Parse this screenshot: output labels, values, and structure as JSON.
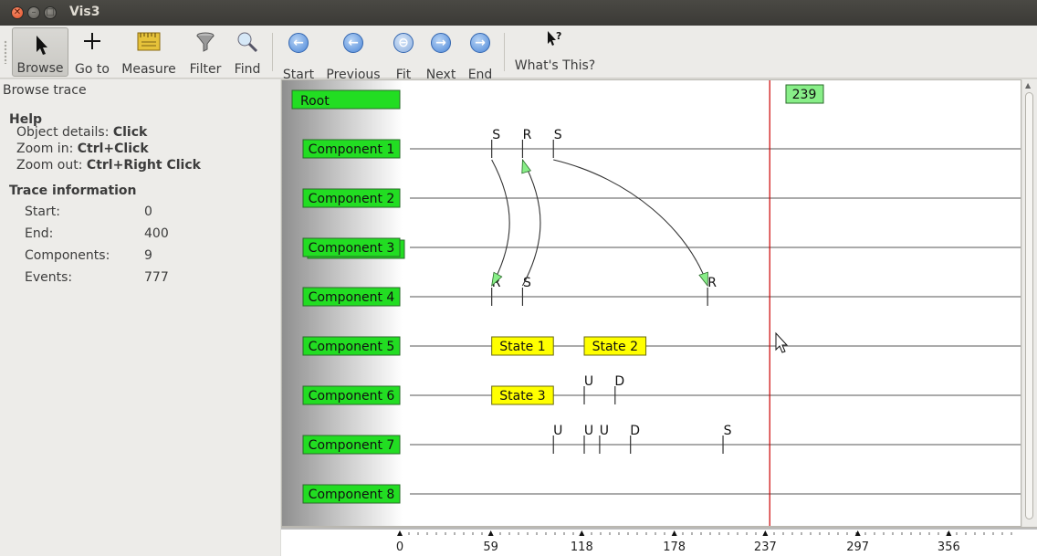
{
  "window": {
    "title": "Vis3",
    "close_glyph": "✕",
    "min_glyph": "–",
    "max_glyph": "□"
  },
  "toolbar": {
    "browse": {
      "label": "Browse",
      "icon": "cursor-arrow-icon"
    },
    "goto": {
      "label": "Go to",
      "icon": "crosshair-icon"
    },
    "measure": {
      "label": "Measure",
      "icon": "ruler-icon"
    },
    "filter": {
      "label": "Filter",
      "icon": "funnel-icon"
    },
    "find": {
      "label": "Find",
      "icon": "magnifier-icon"
    },
    "start": {
      "label": "Start",
      "icon": "arrow-left-icon"
    },
    "previous": {
      "label": "Previous",
      "icon": "arrow-left-icon"
    },
    "fit": {
      "label": "Fit",
      "icon": "fit-icon"
    },
    "next": {
      "label": "Next",
      "icon": "arrow-right-icon"
    },
    "end": {
      "label": "End",
      "icon": "arrow-right-icon"
    },
    "whats_this": {
      "label": "What's This?",
      "icon": "pointer-question-icon"
    }
  },
  "left_panel": {
    "header": "Browse trace",
    "help": {
      "title": "Help",
      "object_details_label": "Object details:",
      "object_details_value": "Click",
      "zoom_in_label": "Zoom in:",
      "zoom_in_value": "Ctrl+Click",
      "zoom_out_label": "Zoom out:",
      "zoom_out_value": "Ctrl+Right Click"
    },
    "trace_info": {
      "title": "Trace information",
      "rows": [
        {
          "label": "Start:",
          "value": "0"
        },
        {
          "label": "End:",
          "value": "400"
        },
        {
          "label": "Components:",
          "value": "9"
        },
        {
          "label": "Events:",
          "value": "777"
        }
      ]
    }
  },
  "trace": {
    "root_label": "Root",
    "cursor_time": "239",
    "cursor_time_value": 239,
    "time_range": [
      0,
      400
    ],
    "components": [
      "Component 1",
      "Component 2",
      "Component 3",
      "Component 4",
      "Component 5",
      "Component 6",
      "Component 7",
      "Component 8"
    ],
    "events": [
      {
        "component": 1,
        "time": 59,
        "label": "S"
      },
      {
        "component": 1,
        "time": 79,
        "label": "R"
      },
      {
        "component": 1,
        "time": 99,
        "label": "S"
      },
      {
        "component": 4,
        "time": 59,
        "label": "R"
      },
      {
        "component": 4,
        "time": 79,
        "label": "S"
      },
      {
        "component": 4,
        "time": 199,
        "label": "R"
      },
      {
        "component": 6,
        "time": 119,
        "label": "U"
      },
      {
        "component": 6,
        "time": 139,
        "label": "D"
      },
      {
        "component": 7,
        "time": 99,
        "label": "U"
      },
      {
        "component": 7,
        "time": 119,
        "label": "U"
      },
      {
        "component": 7,
        "time": 129,
        "label": "U"
      },
      {
        "component": 7,
        "time": 149,
        "label": "D"
      },
      {
        "component": 7,
        "time": 209,
        "label": "S"
      }
    ],
    "states": [
      {
        "component": 5,
        "start": 59,
        "end": 99,
        "label": "State 1"
      },
      {
        "component": 5,
        "start": 119,
        "end": 159,
        "label": "State 2"
      },
      {
        "component": 6,
        "start": 59,
        "end": 99,
        "label": "State 3"
      }
    ],
    "messages": [
      {
        "from_component": 1,
        "from_time": 59,
        "to_component": 4,
        "to_time": 59
      },
      {
        "from_component": 4,
        "from_time": 79,
        "to_component": 1,
        "to_time": 79
      },
      {
        "from_component": 1,
        "from_time": 99,
        "to_component": 4,
        "to_time": 199
      }
    ],
    "ticks": [
      "0",
      "59",
      "118",
      "178",
      "237",
      "297",
      "356"
    ],
    "tick_values": [
      0,
      59,
      118,
      178,
      237,
      297,
      356
    ],
    "colors": {
      "component_fill": "#22dd22",
      "state_fill": "#ffff00",
      "cursor": "#cc0000",
      "time_badge_fill": "#88ee88",
      "message_arrow": "#88ee88"
    }
  }
}
